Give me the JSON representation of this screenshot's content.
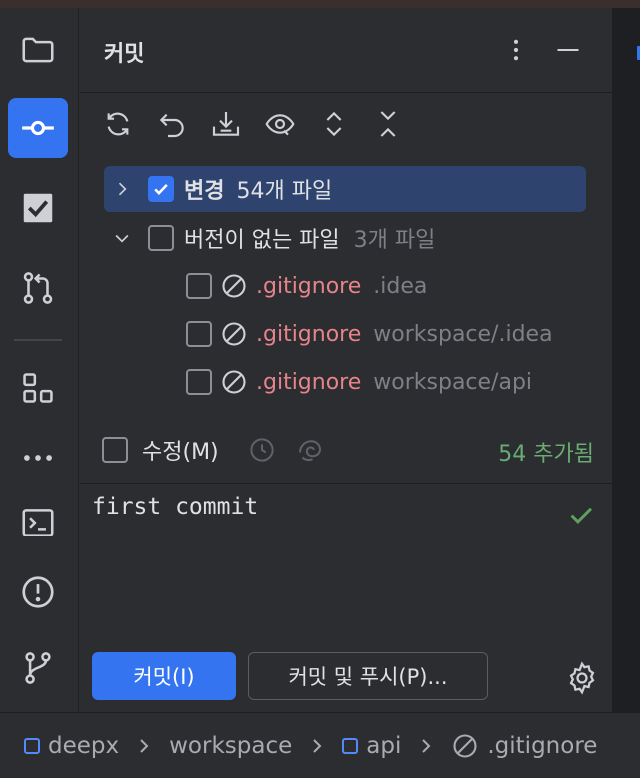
{
  "toolstrip": {
    "items": [
      {
        "name": "project-folder-icon"
      },
      {
        "name": "commit-icon",
        "active": true
      },
      {
        "name": "todo-check-icon"
      },
      {
        "name": "pull-requests-icon"
      },
      {
        "name": "structure-icon"
      },
      {
        "name": "more-icon"
      },
      {
        "name": "terminal-icon"
      },
      {
        "name": "problems-icon"
      },
      {
        "name": "git-branch-icon"
      }
    ]
  },
  "panel": {
    "title": "커밋"
  },
  "tree": {
    "changes": {
      "label": "변경",
      "count": "54개 파일",
      "checked": true
    },
    "unversioned": {
      "label": "버전이 없는 파일",
      "count": "3개 파일",
      "checked": false
    },
    "files": [
      {
        "name": ".gitignore",
        "path": ".idea"
      },
      {
        "name": ".gitignore",
        "path": "workspace/.idea"
      },
      {
        "name": ".gitignore",
        "path": "workspace/api"
      }
    ]
  },
  "amend": {
    "label": "수정(M)",
    "added": "54 추가됨"
  },
  "message": {
    "text": "first commit"
  },
  "buttons": {
    "commit": "커밋(I)",
    "commit_push": "커밋 및 푸시(P)..."
  },
  "breadcrumb": {
    "items": [
      "deepx",
      "workspace",
      "api",
      ".gitignore"
    ]
  },
  "colors": {
    "accent": "#3574f0",
    "selection": "#2e436e",
    "ignored_file": "#e5848a",
    "added": "#6aab73"
  }
}
